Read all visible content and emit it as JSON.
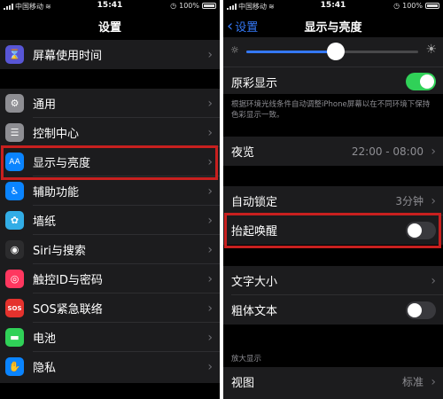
{
  "left": {
    "status": {
      "carrier": "中国移动",
      "time": "15:41",
      "battery": "100%"
    },
    "title": "设置",
    "items": [
      {
        "label": "屏幕使用时间",
        "icon": "hourglass-icon",
        "color": "#5856d6"
      },
      {
        "label": "通用",
        "icon": "gear-icon",
        "color": "#8e8e93"
      },
      {
        "label": "控制中心",
        "icon": "toggles-icon",
        "color": "#8e8e93"
      },
      {
        "label": "显示与亮度",
        "icon": "display-icon",
        "color": "#0a84ff"
      },
      {
        "label": "辅助功能",
        "icon": "accessibility-icon",
        "color": "#0a84ff"
      },
      {
        "label": "墙纸",
        "icon": "flower-icon",
        "color": "#32ade6"
      },
      {
        "label": "Siri与搜索",
        "icon": "siri-icon",
        "color": "#2c2c2e"
      },
      {
        "label": "触控ID与密码",
        "icon": "fingerprint-icon",
        "color": "#ff375f"
      },
      {
        "label": "SOS紧急联络",
        "icon": "sos-icon",
        "color": "#e5322d"
      },
      {
        "label": "电池",
        "icon": "battery-icon",
        "color": "#30d158"
      },
      {
        "label": "隐私",
        "icon": "hand-icon",
        "color": "#0a84ff"
      }
    ]
  },
  "right": {
    "status": {
      "carrier": "中国移动",
      "time": "15:41",
      "battery": "100%"
    },
    "back_label": "设置",
    "title": "显示与亮度",
    "brightness_level": 0.52,
    "true_tone": {
      "label": "原彩显示",
      "on": true
    },
    "true_tone_note": "根据环境光线条件自动调整iPhone屏幕以在不同环境下保持色彩显示一致。",
    "night_shift": {
      "label": "夜览",
      "value": "22:00 - 08:00"
    },
    "auto_lock": {
      "label": "自动锁定",
      "value": "3分钟"
    },
    "raise_to_wake": {
      "label": "抬起唤醒",
      "on": false
    },
    "text_size": {
      "label": "文字大小"
    },
    "bold_text": {
      "label": "粗体文本",
      "on": false
    },
    "zoom_header": "放大显示",
    "view": {
      "label": "视图",
      "value": "标准"
    }
  },
  "colors": {
    "accent": "#3478f6",
    "highlight": "#c8201f",
    "toggle_on": "#30d158"
  }
}
